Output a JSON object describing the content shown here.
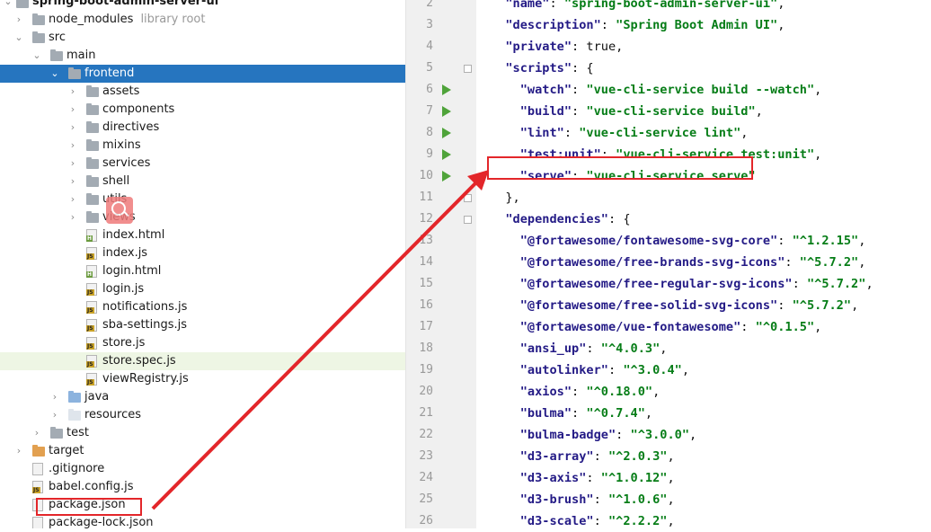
{
  "project_tree": {
    "root_label": "spring-boot-admin-server-ui",
    "items": [
      {
        "label": "node_modules",
        "hint": "library root",
        "type": "folder-gray",
        "depth": 0,
        "expanded": false
      },
      {
        "label": "src",
        "type": "folder-gray",
        "depth": 0,
        "expanded": true
      },
      {
        "label": "main",
        "type": "folder-gray",
        "depth": 1,
        "expanded": true
      },
      {
        "label": "frontend",
        "type": "folder-gray",
        "depth": 2,
        "expanded": true,
        "selected": true
      },
      {
        "label": "assets",
        "type": "folder-gray",
        "depth": 3,
        "expanded": false
      },
      {
        "label": "components",
        "type": "folder-gray",
        "depth": 3,
        "expanded": false
      },
      {
        "label": "directives",
        "type": "folder-gray",
        "depth": 3,
        "expanded": false
      },
      {
        "label": "mixins",
        "type": "folder-gray",
        "depth": 3,
        "expanded": false
      },
      {
        "label": "services",
        "type": "folder-gray",
        "depth": 3,
        "expanded": false
      },
      {
        "label": "shell",
        "type": "folder-gray",
        "depth": 3,
        "expanded": false
      },
      {
        "label": "utils",
        "type": "folder-gray",
        "depth": 3,
        "expanded": false
      },
      {
        "label": "views",
        "type": "folder-gray",
        "depth": 3,
        "expanded": false
      },
      {
        "label": "index.html",
        "type": "file-html",
        "depth": 3
      },
      {
        "label": "index.js",
        "type": "file-js",
        "depth": 3
      },
      {
        "label": "login.html",
        "type": "file-html",
        "depth": 3
      },
      {
        "label": "login.js",
        "type": "file-js",
        "depth": 3
      },
      {
        "label": "notifications.js",
        "type": "file-js",
        "depth": 3
      },
      {
        "label": "sba-settings.js",
        "type": "file-js",
        "depth": 3
      },
      {
        "label": "store.js",
        "type": "file-js",
        "depth": 3
      },
      {
        "label": "store.spec.js",
        "type": "file-js",
        "depth": 3,
        "highlighted": true
      },
      {
        "label": "viewRegistry.js",
        "type": "file-js",
        "depth": 3
      },
      {
        "label": "java",
        "type": "folder-blue",
        "depth": 2,
        "expanded": false
      },
      {
        "label": "resources",
        "type": "folder-white",
        "depth": 2,
        "expanded": false
      },
      {
        "label": "test",
        "type": "folder-gray",
        "depth": 1,
        "expanded": false
      },
      {
        "label": "target",
        "type": "folder-orange",
        "depth": 0,
        "expanded": false
      },
      {
        "label": ".gitignore",
        "type": "file-plain",
        "depth": 0
      },
      {
        "label": "babel.config.js",
        "type": "file-js",
        "depth": 0
      },
      {
        "label": "package.json",
        "type": "file-plain",
        "depth": 0,
        "boxed": true
      },
      {
        "label": "package-lock.json",
        "type": "file-plain",
        "depth": 0
      }
    ]
  },
  "editor": {
    "lines": [
      {
        "n": "2",
        "parts": [
          [
            "p",
            "  "
          ],
          [
            "k",
            "\"name\""
          ],
          [
            "p",
            ": "
          ],
          [
            "s",
            "\"spring-boot-admin-server-ui\""
          ],
          [
            "p",
            ","
          ]
        ]
      },
      {
        "n": "3",
        "parts": [
          [
            "p",
            "  "
          ],
          [
            "k",
            "\"description\""
          ],
          [
            "p",
            ": "
          ],
          [
            "s",
            "\"Spring Boot Admin UI\""
          ],
          [
            "p",
            ","
          ]
        ]
      },
      {
        "n": "4",
        "parts": [
          [
            "p",
            "  "
          ],
          [
            "k",
            "\"private\""
          ],
          [
            "p",
            ": "
          ],
          [
            "kw",
            "true"
          ],
          [
            "p",
            ","
          ]
        ]
      },
      {
        "n": "5",
        "parts": [
          [
            "p",
            "  "
          ],
          [
            "k",
            "\"scripts\""
          ],
          [
            "p",
            ": {"
          ]
        ],
        "fold": true
      },
      {
        "n": "6",
        "parts": [
          [
            "p",
            "    "
          ],
          [
            "k",
            "\"watch\""
          ],
          [
            "p",
            ": "
          ],
          [
            "s",
            "\"vue-cli-service build --watch\""
          ],
          [
            "p",
            ","
          ]
        ],
        "run": true
      },
      {
        "n": "7",
        "parts": [
          [
            "p",
            "    "
          ],
          [
            "k",
            "\"build\""
          ],
          [
            "p",
            ": "
          ],
          [
            "s",
            "\"vue-cli-service build\""
          ],
          [
            "p",
            ","
          ]
        ],
        "run": true
      },
      {
        "n": "8",
        "parts": [
          [
            "p",
            "    "
          ],
          [
            "k",
            "\"lint\""
          ],
          [
            "p",
            ": "
          ],
          [
            "s",
            "\"vue-cli-service lint\""
          ],
          [
            "p",
            ","
          ]
        ],
        "run": true
      },
      {
        "n": "9",
        "parts": [
          [
            "p",
            "    "
          ],
          [
            "k",
            "\"test:unit\""
          ],
          [
            "p",
            ": "
          ],
          [
            "s",
            "\"vue-cli-service test:unit\""
          ],
          [
            "p",
            ","
          ]
        ],
        "run": true
      },
      {
        "n": "10",
        "parts": [
          [
            "p",
            "    "
          ],
          [
            "k",
            "\"serve\""
          ],
          [
            "p",
            ": "
          ],
          [
            "s",
            "\"vue-cli-service serve\""
          ]
        ],
        "run": true,
        "boxed": true
      },
      {
        "n": "11",
        "parts": [
          [
            "p",
            "  },"
          ]
        ],
        "fold": true
      },
      {
        "n": "12",
        "parts": [
          [
            "p",
            "  "
          ],
          [
            "k",
            "\"dependencies\""
          ],
          [
            "p",
            ": {"
          ]
        ],
        "fold": true
      },
      {
        "n": "13",
        "parts": [
          [
            "p",
            "    "
          ],
          [
            "k",
            "\"@fortawesome/fontawesome-svg-core\""
          ],
          [
            "p",
            ": "
          ],
          [
            "s",
            "\"^1.2.15\""
          ],
          [
            "p",
            ","
          ]
        ]
      },
      {
        "n": "14",
        "parts": [
          [
            "p",
            "    "
          ],
          [
            "k",
            "\"@fortawesome/free-brands-svg-icons\""
          ],
          [
            "p",
            ": "
          ],
          [
            "s",
            "\"^5.7.2\""
          ],
          [
            "p",
            ","
          ]
        ]
      },
      {
        "n": "15",
        "parts": [
          [
            "p",
            "    "
          ],
          [
            "k",
            "\"@fortawesome/free-regular-svg-icons\""
          ],
          [
            "p",
            ": "
          ],
          [
            "s",
            "\"^5.7.2\""
          ],
          [
            "p",
            ","
          ]
        ]
      },
      {
        "n": "16",
        "parts": [
          [
            "p",
            "    "
          ],
          [
            "k",
            "\"@fortawesome/free-solid-svg-icons\""
          ],
          [
            "p",
            ": "
          ],
          [
            "s",
            "\"^5.7.2\""
          ],
          [
            "p",
            ","
          ]
        ]
      },
      {
        "n": "17",
        "parts": [
          [
            "p",
            "    "
          ],
          [
            "k",
            "\"@fortawesome/vue-fontawesome\""
          ],
          [
            "p",
            ": "
          ],
          [
            "s",
            "\"^0.1.5\""
          ],
          [
            "p",
            ","
          ]
        ]
      },
      {
        "n": "18",
        "parts": [
          [
            "p",
            "    "
          ],
          [
            "k",
            "\"ansi_up\""
          ],
          [
            "p",
            ": "
          ],
          [
            "s",
            "\"^4.0.3\""
          ],
          [
            "p",
            ","
          ]
        ]
      },
      {
        "n": "19",
        "parts": [
          [
            "p",
            "    "
          ],
          [
            "k",
            "\"autolinker\""
          ],
          [
            "p",
            ": "
          ],
          [
            "s",
            "\"^3.0.4\""
          ],
          [
            "p",
            ","
          ]
        ]
      },
      {
        "n": "20",
        "parts": [
          [
            "p",
            "    "
          ],
          [
            "k",
            "\"axios\""
          ],
          [
            "p",
            ": "
          ],
          [
            "s",
            "\"^0.18.0\""
          ],
          [
            "p",
            ","
          ]
        ]
      },
      {
        "n": "21",
        "parts": [
          [
            "p",
            "    "
          ],
          [
            "k",
            "\"bulma\""
          ],
          [
            "p",
            ": "
          ],
          [
            "s",
            "\"^0.7.4\""
          ],
          [
            "p",
            ","
          ]
        ]
      },
      {
        "n": "22",
        "parts": [
          [
            "p",
            "    "
          ],
          [
            "k",
            "\"bulma-badge\""
          ],
          [
            "p",
            ": "
          ],
          [
            "s",
            "\"^3.0.0\""
          ],
          [
            "p",
            ","
          ]
        ]
      },
      {
        "n": "23",
        "parts": [
          [
            "p",
            "    "
          ],
          [
            "k",
            "\"d3-array\""
          ],
          [
            "p",
            ": "
          ],
          [
            "s",
            "\"^2.0.3\""
          ],
          [
            "p",
            ","
          ]
        ]
      },
      {
        "n": "24",
        "parts": [
          [
            "p",
            "    "
          ],
          [
            "k",
            "\"d3-axis\""
          ],
          [
            "p",
            ": "
          ],
          [
            "s",
            "\"^1.0.12\""
          ],
          [
            "p",
            ","
          ]
        ]
      },
      {
        "n": "25",
        "parts": [
          [
            "p",
            "    "
          ],
          [
            "k",
            "\"d3-brush\""
          ],
          [
            "p",
            ": "
          ],
          [
            "s",
            "\"^1.0.6\""
          ],
          [
            "p",
            ","
          ]
        ]
      },
      {
        "n": "26",
        "parts": [
          [
            "p",
            "    "
          ],
          [
            "k",
            "\"d3-scale\""
          ],
          [
            "p",
            ": "
          ],
          [
            "s",
            "\"^2.2.2\""
          ],
          [
            "p",
            ","
          ]
        ]
      }
    ]
  },
  "colors": {
    "selection": "#2675bf",
    "annotation": "#e3262a",
    "run_icon": "#4fa33a"
  },
  "icons": {
    "magnifier": "search-icon",
    "run": "run-icon",
    "fold": "fold-icon"
  }
}
